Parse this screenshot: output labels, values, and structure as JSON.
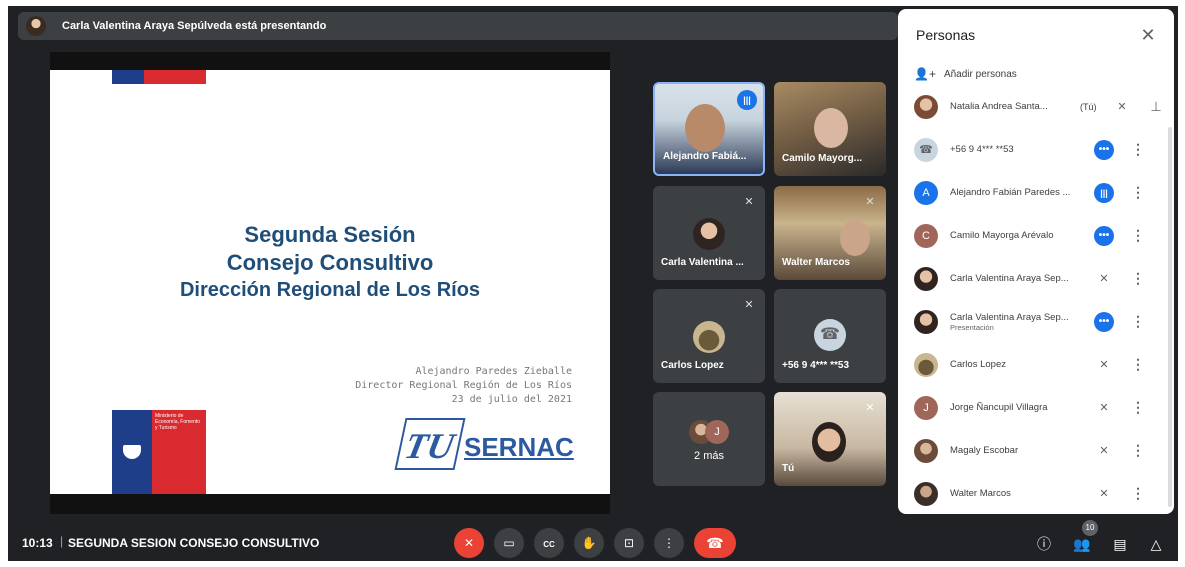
{
  "banner": {
    "text": "Carla Valentina Araya Sepúlveda está presentando"
  },
  "slide": {
    "title_line1": "Segunda Sesión",
    "title_line2": "Consejo Consultivo",
    "title_line3": "Dirección Regional de Los Ríos",
    "presenter_name": "Alejandro Paredes Zieballe",
    "presenter_role": "Director Regional Región de Los Ríos",
    "date": "23 de julio del 2021",
    "gov_logo_text": "Ministerio de Economía, Fomento y Turismo",
    "sernac_tu": "TU",
    "sernac_word": "SERNAC"
  },
  "tiles": [
    {
      "name": "Alejandro Fabiá...",
      "speaking": true
    },
    {
      "name": "Camilo Mayorg..."
    },
    {
      "name": "Carla Valentina ..."
    },
    {
      "name": "Walter Marcos"
    },
    {
      "name": "Carlos Lopez"
    },
    {
      "name": "+56 9 4*** **53"
    },
    {
      "more_label": "2 más",
      "more_initial": "J"
    },
    {
      "name": "Tú"
    }
  ],
  "panel": {
    "title": "Personas",
    "add_people": "Añadir personas",
    "participants": [
      {
        "name": "Natalia Andrea Santa...",
        "tag": "(Tú)",
        "avatar": "",
        "status": "muted"
      },
      {
        "name": "+56 9 4*** **53",
        "avatar": "",
        "status": "dots"
      },
      {
        "name": "Alejandro Fabián Paredes ...",
        "avatar": "A",
        "status": "bars"
      },
      {
        "name": "Camilo Mayorga Arévalo",
        "avatar": "C",
        "status": "dots"
      },
      {
        "name": "Carla Valentina Araya Sep...",
        "avatar": "",
        "status": "muted"
      },
      {
        "name": "Carla Valentina Araya Sep...",
        "sub": "Presentación",
        "avatar": "",
        "status": "dots"
      },
      {
        "name": "Carlos Lopez",
        "avatar": "",
        "status": "muted"
      },
      {
        "name": "Jorge Ñancupil Villagra",
        "avatar": "J",
        "status": "muted"
      },
      {
        "name": "Magaly Escobar",
        "avatar": "",
        "status": "muted"
      },
      {
        "name": "Walter Marcos",
        "avatar": "",
        "status": "muted"
      }
    ]
  },
  "bottom": {
    "time": "10:13",
    "separator": "|",
    "meeting_name": "SEGUNDA SESION CONSEJO CONSULTIVO",
    "participants_count": "10",
    "cc_label": "CC"
  },
  "colors": {
    "accent": "#1a73e8",
    "danger": "#ea4335",
    "surface": "#202124",
    "tile": "#3c4043"
  }
}
